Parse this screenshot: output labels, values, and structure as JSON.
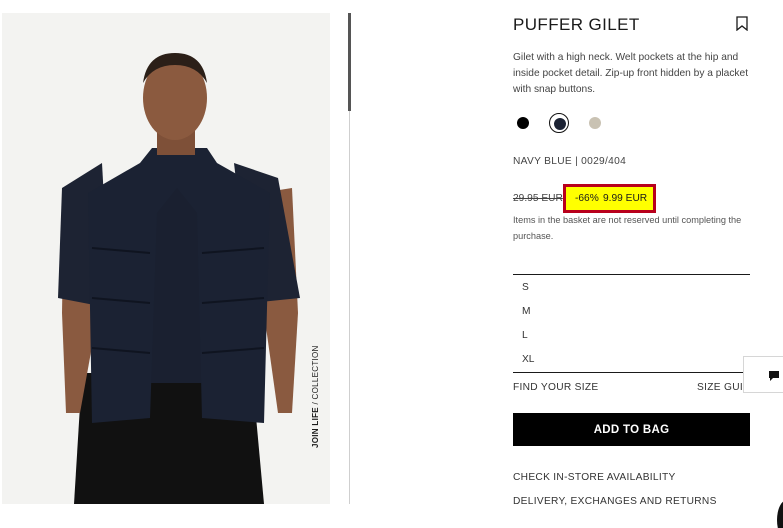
{
  "product": {
    "title": "PUFFER GILET",
    "description": "Gilet with a high neck. Welt pockets at the hip and inside pocket detail. Zip-up front hidden by a placket with snap buttons.",
    "color_code": "NAVY BLUE | 0029/404",
    "photo_label_bold": "JOIN LIFE",
    "photo_label_rest": " / COLLECTION"
  },
  "colors": [
    {
      "name": "black",
      "hex": "#000000",
      "selected": false
    },
    {
      "name": "navy",
      "hex": "#1b2233",
      "selected": true
    },
    {
      "name": "beige",
      "hex": "#c9c2b3",
      "selected": false
    }
  ],
  "price": {
    "old": "29.95 EUR",
    "discount": "-66%",
    "sale": "9.99 EUR",
    "highlight_color": "#ffff00",
    "border_color": "#b8001c"
  },
  "notice": "Items in the basket are not reserved until completing the purchase.",
  "sizes": [
    "S",
    "M",
    "L",
    "XL"
  ],
  "links": {
    "find_size": "FIND YOUR SIZE",
    "size_guide": "SIZE GUIDE",
    "store_availability": "CHECK IN-STORE AVAILABILITY",
    "delivery": "DELIVERY, EXCHANGES AND RETURNS"
  },
  "buttons": {
    "add_to_bag": "ADD TO BAG"
  },
  "icons": {
    "bookmark": "bookmark-icon",
    "chat": "chat-icon"
  }
}
